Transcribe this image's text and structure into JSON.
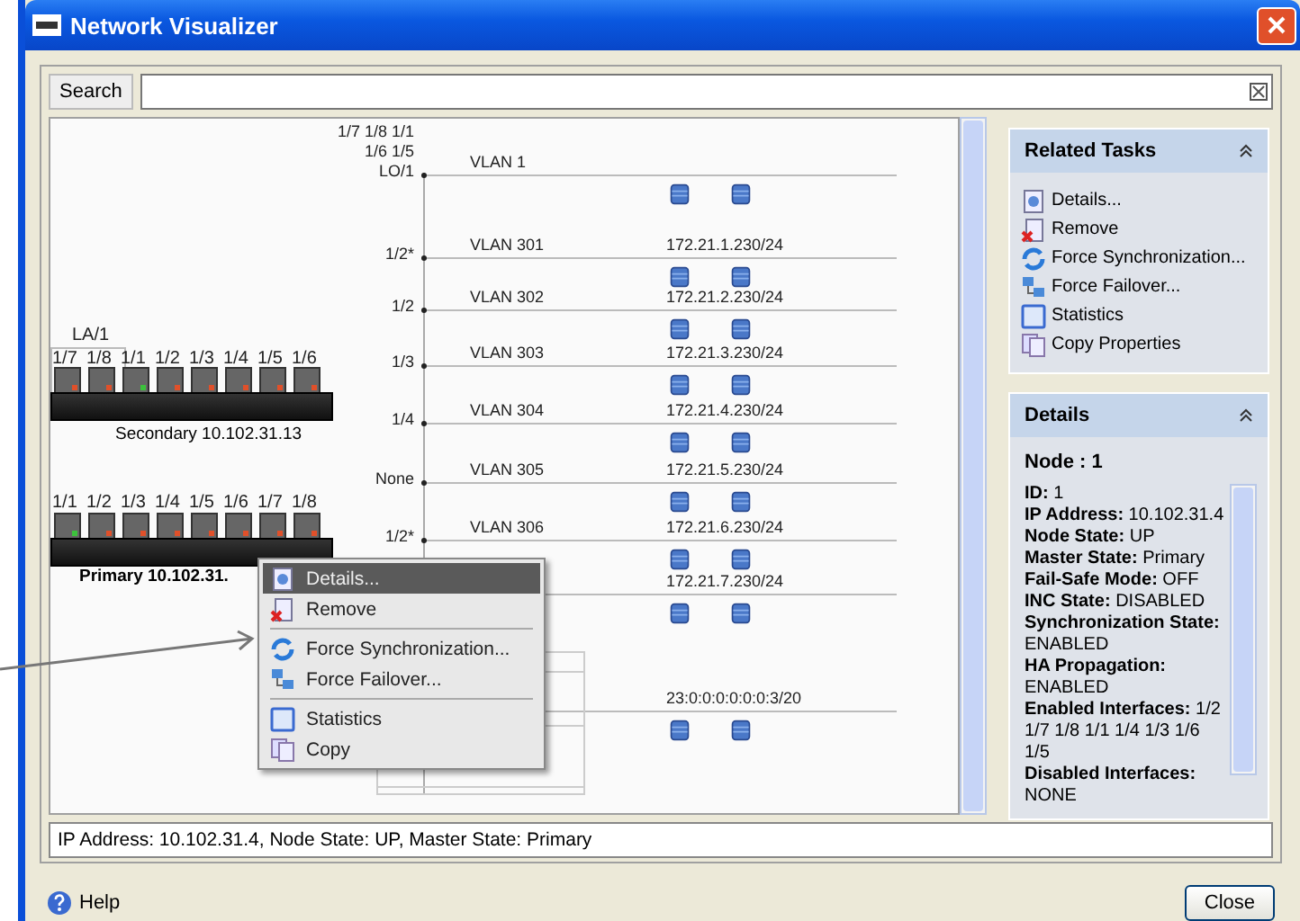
{
  "window": {
    "title": "Network Visualizer"
  },
  "search": {
    "label": "Search"
  },
  "diagram": {
    "devices": [
      {
        "label": "Secondary 10.102.31.13",
        "primary": false,
        "group_label": "LA/1",
        "ports": [
          {
            "name": "1/7",
            "color": "#e0502a",
            "grouped": true
          },
          {
            "name": "1/8",
            "color": "#e0502a",
            "grouped": true
          },
          {
            "name": "1/1",
            "color": "#3cc23c",
            "grouped": false
          },
          {
            "name": "1/2",
            "color": "#e0502a",
            "grouped": false
          },
          {
            "name": "1/3",
            "color": "#e0502a",
            "grouped": false
          },
          {
            "name": "1/4",
            "color": "#e0502a",
            "grouped": false
          },
          {
            "name": "1/5",
            "color": "#e0502a",
            "grouped": false
          },
          {
            "name": "1/6",
            "color": "#e0502a",
            "grouped": false
          }
        ]
      },
      {
        "label": "Primary 10.102.31.",
        "primary": true,
        "ports": [
          {
            "name": "1/1",
            "color": "#3cc23c",
            "grouped": false
          },
          {
            "name": "1/2",
            "color": "#e0502a",
            "grouped": false
          },
          {
            "name": "1/3",
            "color": "#e0502a",
            "grouped": false
          },
          {
            "name": "1/4",
            "color": "#e0502a",
            "grouped": false
          },
          {
            "name": "1/5",
            "color": "#e0502a",
            "grouped": false
          },
          {
            "name": "1/6",
            "color": "#e0502a",
            "grouped": false
          },
          {
            "name": "1/7",
            "color": "#e0502a",
            "grouped": false
          },
          {
            "name": "1/8",
            "color": "#e0502a",
            "grouped": false
          }
        ]
      }
    ],
    "vlans": [
      {
        "ports": [
          "1/7 1/8 1/1",
          "1/6 1/5",
          "LO/1"
        ],
        "name": "VLAN 1"
      },
      {
        "ports": [
          "1/2*"
        ],
        "name": "VLAN 301",
        "subnet": "172.21.1.230/24"
      },
      {
        "ports": [
          "1/2"
        ],
        "name": "VLAN 302",
        "subnet": "172.21.2.230/24"
      },
      {
        "ports": [
          "1/3"
        ],
        "name": "VLAN 303",
        "subnet": "172.21.3.230/24"
      },
      {
        "ports": [
          "1/4"
        ],
        "name": "VLAN 304",
        "subnet": "172.21.4.230/24"
      },
      {
        "ports": [
          "None"
        ],
        "name": "VLAN 305",
        "subnet": "172.21.5.230/24"
      },
      {
        "ports": [
          "1/2*"
        ],
        "name": "VLAN 306",
        "subnet": "172.21.6.230/24"
      },
      {
        "subnet": "172.21.7.230/24"
      },
      {
        "subnet": "23:0:0:0:0:0:0:3/20"
      }
    ]
  },
  "context_menu": [
    {
      "kind": "details",
      "label": "Details...",
      "selected": true,
      "separator_before": false
    },
    {
      "kind": "remove",
      "label": "Remove",
      "selected": false,
      "separator_before": false
    },
    {
      "kind": "sync",
      "label": "Force Synchronization...",
      "selected": false,
      "separator_before": true
    },
    {
      "kind": "failover",
      "label": "Force Failover...",
      "selected": false,
      "separator_before": false
    },
    {
      "kind": "statistics",
      "label": "Statistics",
      "selected": false,
      "separator_before": true
    },
    {
      "kind": "copy",
      "label": "Copy",
      "selected": false,
      "separator_before": false
    }
  ],
  "related_tasks": {
    "title": "Related Tasks",
    "items": [
      {
        "kind": "details",
        "label": "Details..."
      },
      {
        "kind": "remove",
        "label": "Remove"
      },
      {
        "kind": "sync",
        "label": "Force Synchronization..."
      },
      {
        "kind": "failover",
        "label": "Force Failover..."
      },
      {
        "kind": "statistics",
        "label": "Statistics"
      },
      {
        "kind": "copy",
        "label": "Copy Properties"
      }
    ]
  },
  "details": {
    "title": "Details",
    "heading": "Node : 1",
    "entries": [
      "**ID:** 1",
      "**IP Address:** 10.102.31.4",
      "**Node State:** UP",
      "**Master State:** Primary",
      "**Fail-Safe Mode:** OFF",
      "**INC State:** DISABLED",
      "**Synchronization State:** ENABLED",
      "**HA Propagation:** ENABLED",
      "**Enabled Interfaces:** 1/2 1/7 1/8 1/1 1/4 1/3 1/6 1/5",
      "**Disabled Interfaces:** NONE"
    ]
  },
  "status_bar": "IP Address: 10.102.31.4, Node State: UP, Master State: Primary",
  "footer": {
    "help": "Help",
    "close": "Close"
  }
}
